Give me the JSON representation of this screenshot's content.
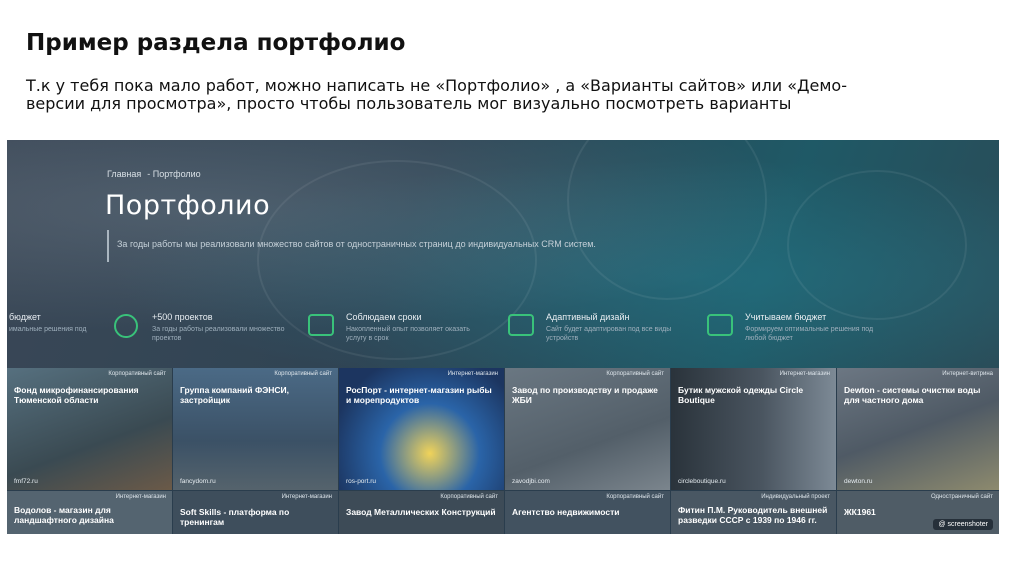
{
  "slide": {
    "title": "Пример раздела портфолио",
    "description": "Т.к у тебя пока мало работ, можно написать не «Портфолио» , а «Варианты сайтов» или «Демо-версии для просмотра», просто чтобы пользователь мог визуально посмотреть варианты"
  },
  "site": {
    "breadcrumb": [
      "Главная",
      "- Портфолио"
    ],
    "hero_title": "Портфолио",
    "hero_subtitle": "За годы работы мы реализовали множество сайтов от одностраничных страниц до индивидуальных CRM систем.",
    "features": [
      {
        "icon": "wallet-icon",
        "title": "бюджет",
        "text": "имальные решения под"
      },
      {
        "icon": "globe-icon",
        "title": "+500 проектов",
        "text": "За годы работы реализовали множество проектов"
      },
      {
        "icon": "calendar-icon",
        "title": "Соблюдаем сроки",
        "text": "Накопленный опыт позволяет оказать услугу в срок"
      },
      {
        "icon": "devices-icon",
        "title": "Адаптивный дизайн",
        "text": "Сайт будет адаптирован под все виды устройств"
      },
      {
        "icon": "briefcase-icon",
        "title": "Учитываем бюджет",
        "text": "Формируем оптимальные решения под любой бюджет"
      }
    ],
    "cards_row1": [
      {
        "tag": "Корпоративный сайт",
        "title": "Фонд микрофинансирования Тюменской области",
        "url": "fmf72.ru",
        "color": "#4a6070"
      },
      {
        "tag": "Корпоративный сайт",
        "title": "Группа компаний ФЭНСИ, застройщик",
        "url": "fancydom.ru",
        "color": "#3f5a73"
      },
      {
        "tag": "Интернет-магазин",
        "title": "РосПорт - интернет-магазин рыбы и морепродуктов",
        "url": "ros-port.ru",
        "color": "#23436b"
      },
      {
        "tag": "Корпоративный сайт",
        "title": "Завод по производству и продаже ЖБИ",
        "url": "zavodjbi.com",
        "color": "#5d6a75"
      },
      {
        "tag": "Интернет-магазин",
        "title": "Бутик мужской одежды Circle Boutique",
        "url": "circleboutique.ru",
        "color": "#2e3a44"
      },
      {
        "tag": "Интернет-витрина",
        "title": "Dewton - системы очистки воды для частного дома",
        "url": "dewton.ru",
        "color": "#5a6571"
      }
    ],
    "cards_row2": [
      {
        "tag": "Интернет-магазин",
        "title": "Водолов - магазин для ландшафтного дизайна"
      },
      {
        "tag": "Интернет-магазин",
        "title": "Soft Skills - платформа по тренингам"
      },
      {
        "tag": "Корпоративный сайт",
        "title": "Завод Металлических Конструкций"
      },
      {
        "tag": "Корпоративный сайт",
        "title": "Агентство недвижимости"
      },
      {
        "tag": "Индивидуальный проект",
        "title": "Фитин П.М. Руководитель внешней разведки СССР с 1939 по 1946 гг."
      },
      {
        "tag": "Одностраничный сайт",
        "title": "ЖК1961"
      }
    ],
    "watermark": "@ screenshoter"
  },
  "colors": {
    "accent": "#39c27a",
    "overlay": "#2a3d4d"
  }
}
